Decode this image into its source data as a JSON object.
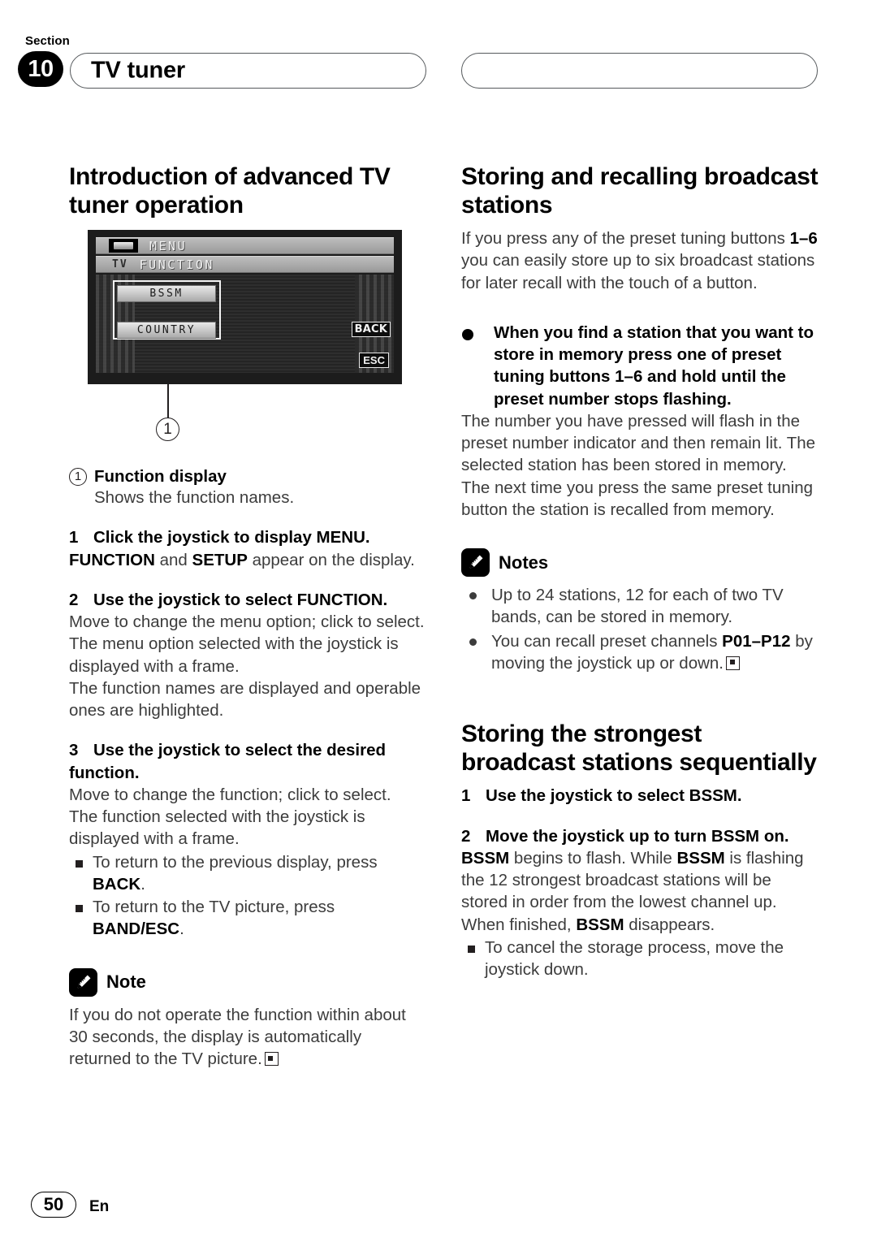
{
  "header": {
    "section_word": "Section",
    "section_number": "10",
    "title": "TV tuner",
    "right_pill": ""
  },
  "left_column": {
    "heading": "Introduction of advanced TV tuner operation",
    "device": {
      "menu_label": "MENU",
      "tv_label": "TV",
      "function_label": "FUNCTION",
      "key1": "BSSM",
      "key2": "COUNTRY",
      "back_key": "BACK",
      "esc_key": "ESC",
      "callout_number": "1"
    },
    "callout": {
      "number": "1",
      "title": "Function display",
      "body": "Shows the function names."
    },
    "step1": {
      "num": "1",
      "title": "Click the joystick to display MENU.",
      "body_pre": "",
      "body_b1": "FUNCTION",
      "body_mid": " and ",
      "body_b2": "SETUP",
      "body_post": " appear on the display."
    },
    "step2": {
      "num": "2",
      "title": "Use the joystick to select FUNCTION.",
      "body": "Move to change the menu option; click to select.\nThe menu option selected with the joystick is displayed with a frame.\nThe function names are displayed and operable ones are highlighted."
    },
    "step3": {
      "num": "3",
      "title": "Use the joystick to select the desired function.",
      "body": "Move to change the function; click to select.\nThe function selected with the joystick is displayed with a frame.",
      "bullets": [
        {
          "pre": "To return to the previous display, press ",
          "b": "BACK",
          "post": "."
        },
        {
          "pre": "To return to the TV picture, press ",
          "b": "BAND/ESC",
          "post": "."
        }
      ]
    },
    "note": {
      "icon": "pencil-icon",
      "label": "Note",
      "body": "If you do not operate the function within about 30 seconds, the display is automatically returned to the TV picture."
    }
  },
  "right_column": {
    "heading1": "Storing and recalling broadcast stations",
    "intro": {
      "pre": "If you press any of the preset tuning buttons ",
      "b": "1–6",
      "post": " you can easily store up to six broadcast stations for later recall with the touch of a button."
    },
    "bold_bullet": "When you find a station that you want to store in memory press one of preset tuning buttons 1–6 and hold until the preset number stops flashing.",
    "bold_bullet_body": "The number you have pressed will flash in the preset number indicator and then remain lit. The selected station has been stored in memory.\nThe next time you press the same preset tuning button the station is recalled from memory.",
    "notes": {
      "icon": "pencil-icon",
      "label": "Notes",
      "items": [
        {
          "pre": "Up to 24 stations, 12 for each of two TV bands, can be stored in memory.",
          "b": "",
          "post": ""
        },
        {
          "pre": "You can recall preset channels ",
          "b": "P01–P12",
          "post": " by moving the joystick up or down."
        }
      ]
    },
    "heading2": "Storing the strongest broadcast stations sequentially",
    "step1": {
      "num": "1",
      "title": "Use the joystick to select BSSM."
    },
    "step2": {
      "num": "2",
      "title": "Move the joystick up to turn BSSM on.",
      "body_b1": "BSSM",
      "body_1": " begins to flash. While ",
      "body_b2": "BSSM",
      "body_2": " is flashing the 12 strongest broadcast stations will be stored in order from the lowest channel up. When finished, ",
      "body_b3": "BSSM",
      "body_3": " disappears.",
      "bullet": "To cancel the storage process, move the joystick down."
    }
  },
  "footer": {
    "page_number": "50",
    "language": "En"
  }
}
